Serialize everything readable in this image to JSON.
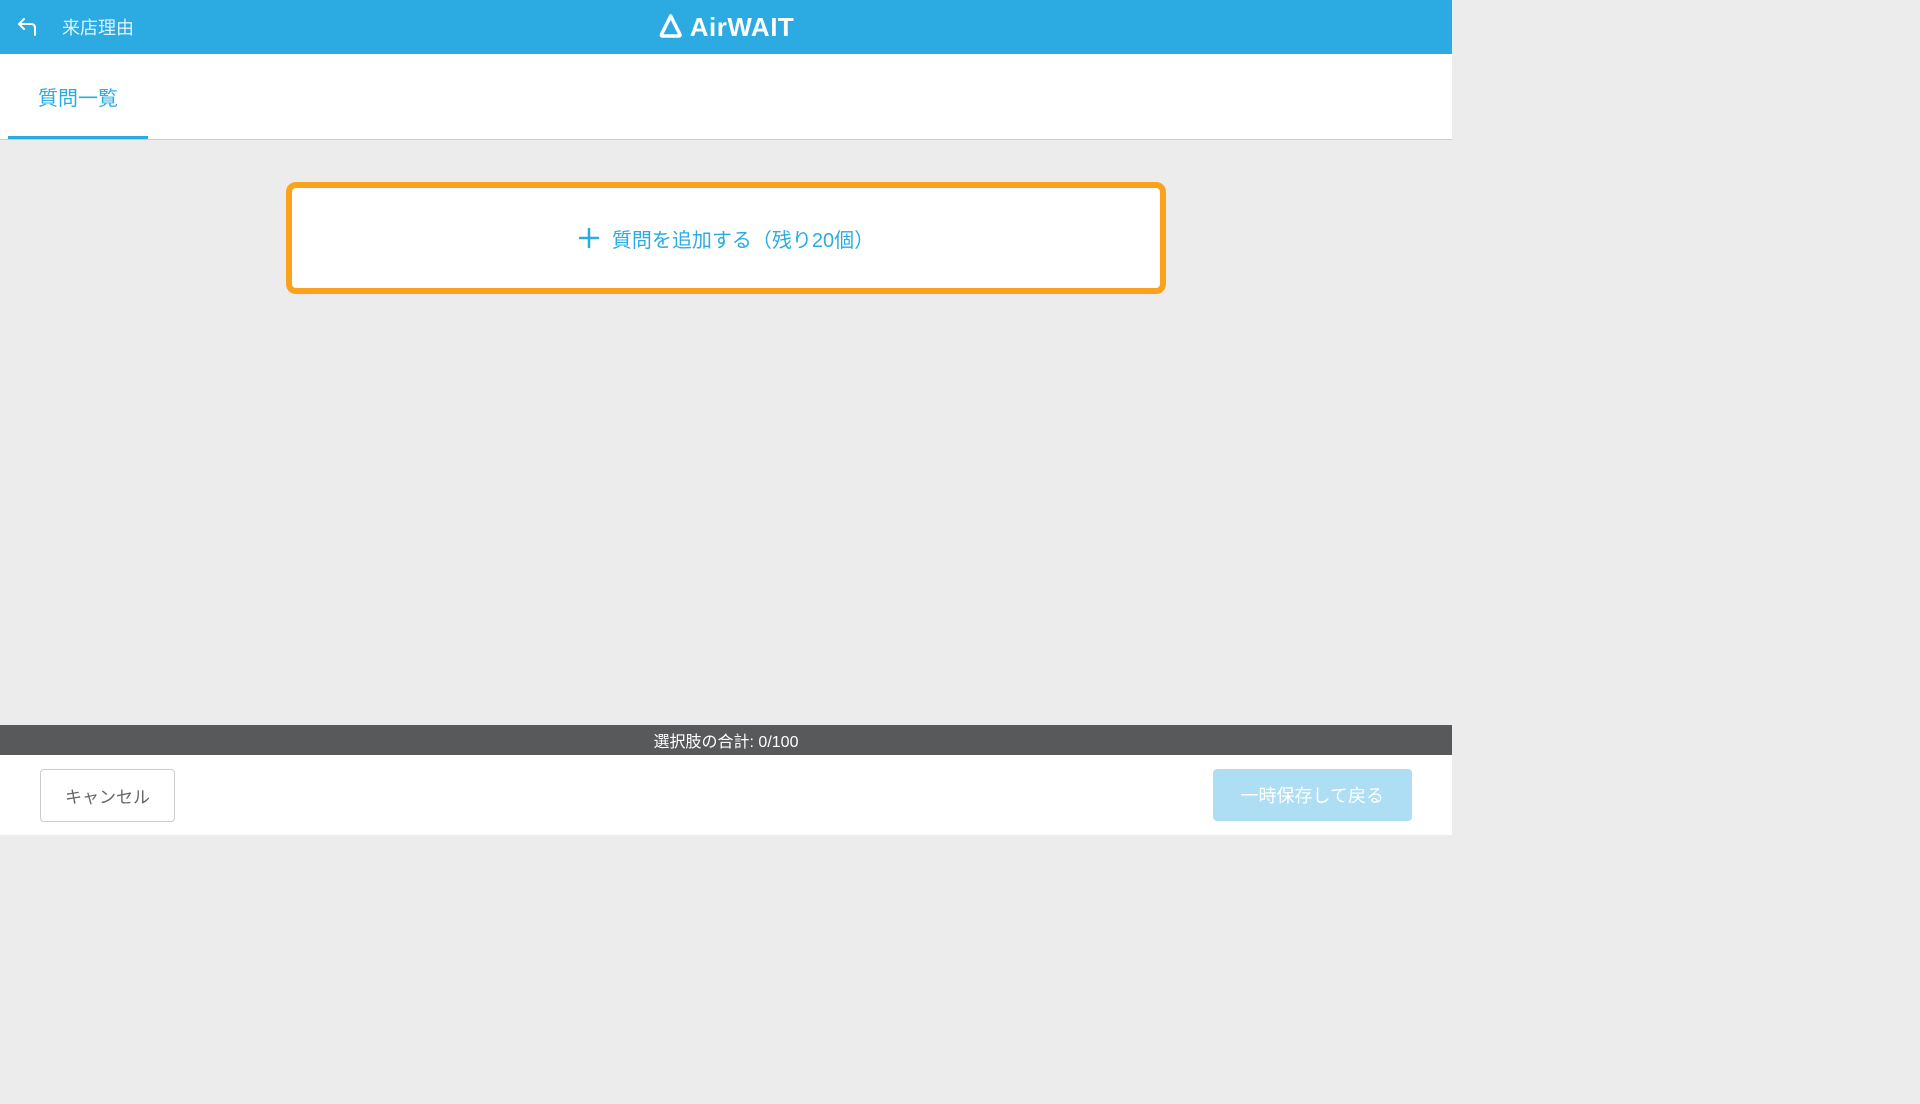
{
  "header": {
    "title": "来店理由",
    "logo_text": "AirWAIT"
  },
  "tabs": {
    "question_list": "質問一覧"
  },
  "add_question": {
    "label": "質問を追加する（残り20個）"
  },
  "status_bar": {
    "text": "選択肢の合計: 0/100"
  },
  "footer": {
    "cancel": "キャンセル",
    "save": "一時保存して戻る"
  }
}
